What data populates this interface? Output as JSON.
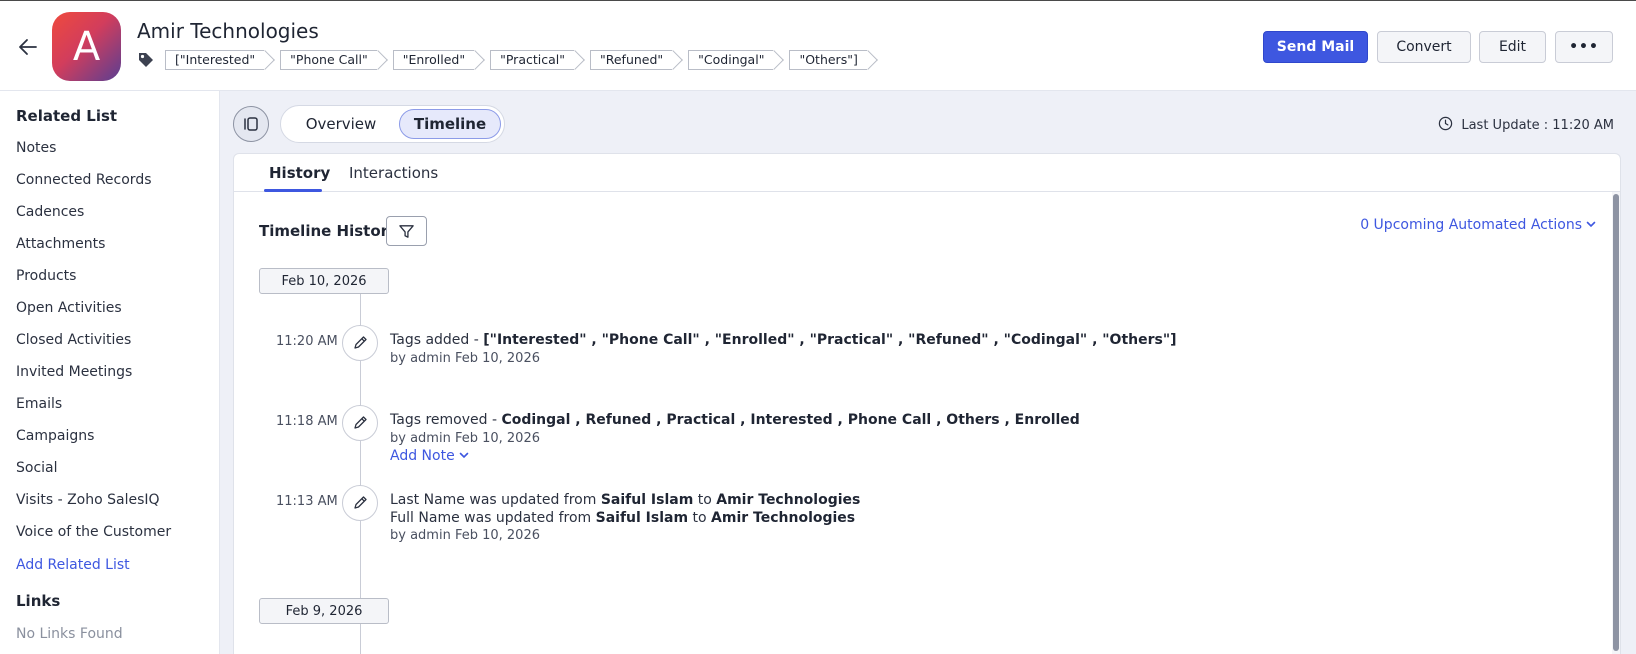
{
  "record": {
    "initial": "A",
    "name": "Amir Technologies",
    "tags": [
      "[\"Interested\"",
      "\"Phone Call\"",
      "\"Enrolled\"",
      "\"Practical\"",
      "\"Refuned\"",
      "\"Codingal\"",
      "\"Others\"]"
    ]
  },
  "actions": {
    "send_mail": "Send Mail",
    "convert": "Convert",
    "edit": "Edit",
    "more": "•••"
  },
  "sidebar": {
    "related_heading": "Related List",
    "items": [
      "Notes",
      "Connected Records",
      "Cadences",
      "Attachments",
      "Products",
      "Open Activities",
      "Closed Activities",
      "Invited Meetings",
      "Emails",
      "Campaigns",
      "Social",
      "Visits - Zoho SalesIQ",
      "Voice of the Customer"
    ],
    "add_related": "Add Related List",
    "links_heading": "Links",
    "no_links": "No Links Found"
  },
  "view": {
    "overview": "Overview",
    "timeline": "Timeline",
    "active": "Timeline",
    "last_update": "Last Update : 11:20 AM"
  },
  "tabs": {
    "history": "History",
    "interactions": "Interactions",
    "active": "History"
  },
  "timeline": {
    "title": "Timeline History",
    "upcoming": "0 Upcoming Automated Actions",
    "groups": [
      {
        "date": "Feb 10, 2026",
        "entries": [
          {
            "time": "11:20 AM",
            "icon": "pencil-icon",
            "prefix": "Tags added - ",
            "bold": "[\"Interested\" , \"Phone Call\" , \"Enrolled\" , \"Practical\" , \"Refuned\" , \"Codingal\" , \"Others\"]",
            "by": "by admin Feb 10, 2026"
          },
          {
            "time": "11:18 AM",
            "icon": "pencil-icon",
            "prefix": "Tags removed - ",
            "bold": "Codingal , Refuned , Practical , Interested , Phone Call , Others , Enrolled",
            "by": "by admin Feb 10, 2026",
            "add_note": "Add Note"
          },
          {
            "time": "11:13 AM",
            "icon": "pencil-icon",
            "line1": {
              "prefix": "Last Name was updated from ",
              "from": "Saiful Islam",
              "mid": " to ",
              "to": "Amir Technologies"
            },
            "line2": {
              "prefix": "Full Name was updated from ",
              "from": "Saiful Islam",
              "mid": " to ",
              "to": "Amir Technologies"
            },
            "by": "by admin Feb 10, 2026"
          }
        ]
      },
      {
        "date": "Feb 9, 2026",
        "entries": []
      }
    ]
  },
  "colors": {
    "accent": "#3e57e0",
    "main_bg": "#eef0f7"
  }
}
